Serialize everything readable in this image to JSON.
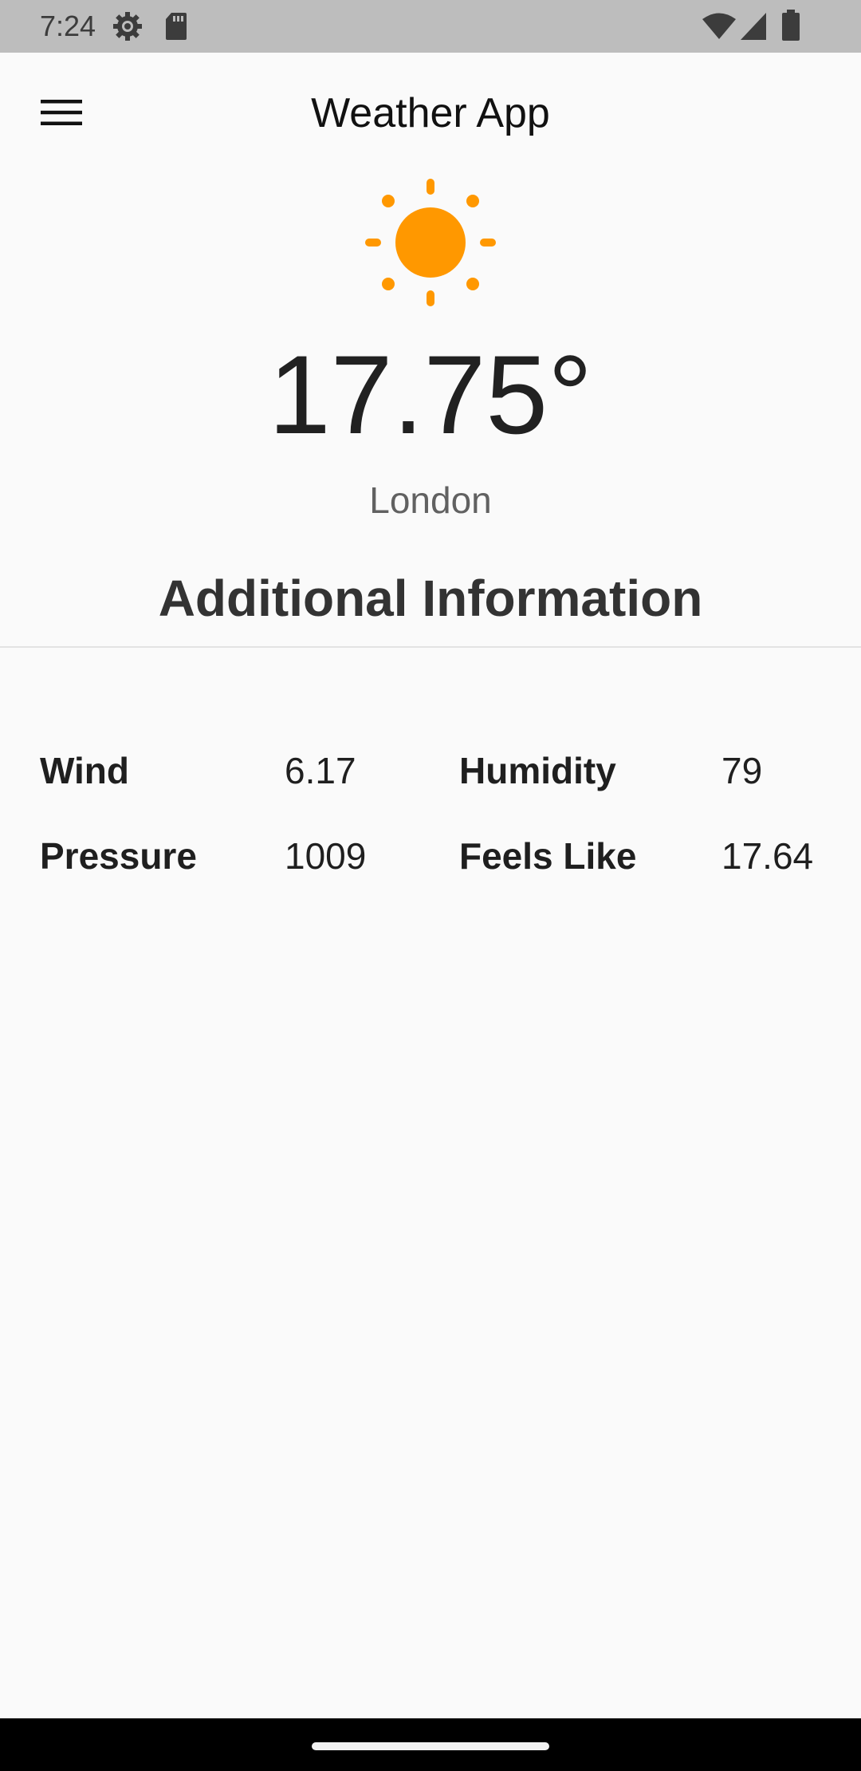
{
  "status_bar": {
    "time": "7:24",
    "icons": [
      "settings-icon",
      "sd-card-icon",
      "wifi-icon",
      "signal-icon",
      "battery-icon"
    ]
  },
  "app_bar": {
    "title": "Weather App",
    "menu_icon": "hamburger-menu-icon"
  },
  "weather": {
    "icon": "sun-icon",
    "icon_color": "#ff9800",
    "temperature": "17.75°",
    "city": "London"
  },
  "additional_info": {
    "title": "Additional Information",
    "rows": [
      [
        {
          "label": "Wind",
          "value": "6.17"
        },
        {
          "label": "Humidity",
          "value": "79"
        }
      ],
      [
        {
          "label": "Pressure",
          "value": "1009"
        },
        {
          "label": "Feels Like",
          "value": "17.64"
        }
      ]
    ]
  }
}
